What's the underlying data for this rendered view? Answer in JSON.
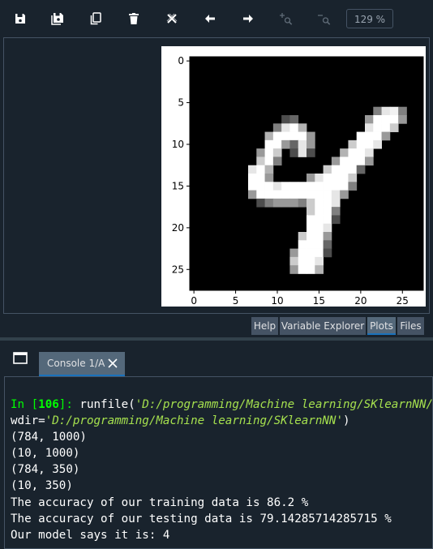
{
  "toolbar": {
    "buttons": [
      {
        "name": "save-icon"
      },
      {
        "name": "save-all-icon"
      },
      {
        "name": "copy-icon"
      },
      {
        "name": "trash-icon"
      },
      {
        "name": "remove-all-icon"
      },
      {
        "name": "arrow-left-icon"
      },
      {
        "name": "arrow-right-icon"
      },
      {
        "name": "zoom-in-icon"
      },
      {
        "name": "zoom-out-icon"
      }
    ],
    "zoom_level": "129 %"
  },
  "chart_data": {
    "type": "heatmap",
    "description_source": "image 28x28 (MNIST digit 4), grayscale",
    "xticks": [
      "0",
      "5",
      "10",
      "15",
      "20",
      "25"
    ],
    "yticks": [
      "0",
      "5",
      "10",
      "15",
      "20",
      "25"
    ],
    "xlim": [
      -0.5,
      27.5
    ],
    "ylim": [
      27.5,
      -0.5
    ],
    "rows": [
      {
        "y": 6,
        "cells": [
          [
            22,
            0.5
          ],
          [
            23,
            0.9
          ],
          [
            24,
            0.95
          ],
          [
            25,
            0.5
          ]
        ]
      },
      {
        "y": 7,
        "cells": [
          [
            11,
            0.3
          ],
          [
            12,
            0.4
          ],
          [
            21,
            0.6
          ],
          [
            22,
            1
          ],
          [
            23,
            1
          ],
          [
            24,
            1
          ],
          [
            25,
            0.6
          ]
        ]
      },
      {
        "y": 8,
        "cells": [
          [
            10,
            0.5
          ],
          [
            11,
            0.9
          ],
          [
            12,
            1
          ],
          [
            13,
            0.7
          ],
          [
            21,
            0.9
          ],
          [
            22,
            1
          ],
          [
            23,
            1
          ],
          [
            24,
            0.8
          ]
        ]
      },
      {
        "y": 9,
        "cells": [
          [
            9,
            0.7
          ],
          [
            10,
            1
          ],
          [
            11,
            1
          ],
          [
            12,
            1
          ],
          [
            13,
            1
          ],
          [
            14,
            0.6
          ],
          [
            20,
            1
          ],
          [
            21,
            1
          ],
          [
            22,
            1
          ],
          [
            23,
            0.6
          ]
        ]
      },
      {
        "y": 10,
        "cells": [
          [
            9,
            1
          ],
          [
            10,
            1
          ],
          [
            11,
            0.6
          ],
          [
            12,
            0.4
          ],
          [
            13,
            0.9
          ],
          [
            14,
            0.6
          ],
          [
            19,
            0.8
          ],
          [
            20,
            1
          ],
          [
            21,
            1
          ],
          [
            22,
            0.9
          ]
        ]
      },
      {
        "y": 11,
        "cells": [
          [
            8,
            0.6
          ],
          [
            9,
            1
          ],
          [
            10,
            0.8
          ],
          [
            12,
            0.3
          ],
          [
            13,
            0.9
          ],
          [
            14,
            0.3
          ],
          [
            18,
            0.7
          ],
          [
            19,
            1
          ],
          [
            20,
            1
          ],
          [
            21,
            0.9
          ]
        ]
      },
      {
        "y": 12,
        "cells": [
          [
            8,
            0.8
          ],
          [
            9,
            1
          ],
          [
            10,
            0.5
          ],
          [
            17,
            0.6
          ],
          [
            18,
            1
          ],
          [
            19,
            1
          ],
          [
            20,
            1
          ],
          [
            21,
            0.6
          ]
        ]
      },
      {
        "y": 13,
        "cells": [
          [
            7,
            0.9
          ],
          [
            8,
            1
          ],
          [
            9,
            0.7
          ],
          [
            16,
            0.8
          ],
          [
            17,
            1
          ],
          [
            18,
            1
          ],
          [
            19,
            1
          ],
          [
            20,
            0.4
          ]
        ]
      },
      {
        "y": 14,
        "cells": [
          [
            7,
            1
          ],
          [
            8,
            1
          ],
          [
            9,
            0.6
          ],
          [
            14,
            0.6
          ],
          [
            15,
            0.9
          ],
          [
            16,
            1
          ],
          [
            17,
            1
          ],
          [
            18,
            1
          ],
          [
            19,
            0.8
          ]
        ]
      },
      {
        "y": 15,
        "cells": [
          [
            7,
            1
          ],
          [
            8,
            1
          ],
          [
            9,
            1
          ],
          [
            10,
            0.9
          ],
          [
            11,
            1
          ],
          [
            12,
            1
          ],
          [
            13,
            1
          ],
          [
            14,
            1
          ],
          [
            15,
            1
          ],
          [
            16,
            1
          ],
          [
            17,
            1
          ],
          [
            18,
            1
          ],
          [
            19,
            0.5
          ]
        ]
      },
      {
        "y": 16,
        "cells": [
          [
            7,
            0.6
          ],
          [
            8,
            1
          ],
          [
            9,
            1
          ],
          [
            10,
            1
          ],
          [
            11,
            1
          ],
          [
            12,
            1
          ],
          [
            13,
            1
          ],
          [
            14,
            1
          ],
          [
            15,
            1
          ],
          [
            16,
            1
          ],
          [
            17,
            0.9
          ],
          [
            18,
            0.6
          ]
        ]
      },
      {
        "y": 17,
        "cells": [
          [
            8,
            0.3
          ],
          [
            9,
            0.5
          ],
          [
            10,
            0.6
          ],
          [
            11,
            0.6
          ],
          [
            12,
            0.6
          ],
          [
            13,
            0.5
          ],
          [
            14,
            0.8
          ],
          [
            15,
            1
          ],
          [
            16,
            1
          ],
          [
            17,
            0.9
          ]
        ]
      },
      {
        "y": 18,
        "cells": [
          [
            14,
            0.8
          ],
          [
            15,
            1
          ],
          [
            16,
            1
          ],
          [
            17,
            0.5
          ]
        ]
      },
      {
        "y": 19,
        "cells": [
          [
            14,
            1
          ],
          [
            15,
            1
          ],
          [
            16,
            1
          ],
          [
            17,
            0.3
          ]
        ]
      },
      {
        "y": 20,
        "cells": [
          [
            14,
            1
          ],
          [
            15,
            1
          ],
          [
            16,
            0.9
          ]
        ]
      },
      {
        "y": 21,
        "cells": [
          [
            13,
            0.8
          ],
          [
            14,
            1
          ],
          [
            15,
            1
          ],
          [
            16,
            0.6
          ]
        ]
      },
      {
        "y": 22,
        "cells": [
          [
            13,
            1
          ],
          [
            14,
            1
          ],
          [
            15,
            1
          ],
          [
            16,
            0.4
          ]
        ]
      },
      {
        "y": 23,
        "cells": [
          [
            12,
            0.6
          ],
          [
            13,
            1
          ],
          [
            14,
            1
          ],
          [
            15,
            1
          ],
          [
            16,
            0.3
          ]
        ]
      },
      {
        "y": 24,
        "cells": [
          [
            12,
            0.8
          ],
          [
            13,
            1
          ],
          [
            14,
            1
          ],
          [
            15,
            0.9
          ]
        ]
      },
      {
        "y": 25,
        "cells": [
          [
            12,
            0.6
          ],
          [
            13,
            1
          ],
          [
            14,
            1
          ],
          [
            15,
            0.7
          ]
        ]
      }
    ]
  },
  "panes": {
    "tabs": [
      {
        "label": "Help",
        "active": false
      },
      {
        "label": "Variable Explorer",
        "active": false
      },
      {
        "label": "Plots",
        "active": true
      },
      {
        "label": "Files",
        "active": false
      }
    ]
  },
  "console": {
    "tab_label": "Console 1/A",
    "prompt_prefix": "In [",
    "prompt_number": "106",
    "prompt_suffix": "]: ",
    "command": "runfile(",
    "command_arg": "'D:/programming/Machine learning/SKlearnNN/main.py'",
    "wdir_prefix": "wdir=",
    "wdir_arg": "'D:/programming/Machine learning/SKlearnNN'",
    "wdir_close": ")",
    "output": [
      "(784, 1000)",
      "(10, 1000)",
      "(784, 350)",
      "(10, 350)",
      "The accuracy of our training data is 86.2 %",
      "The accuracy of our testing data is 79.14285714285715 %",
      "Our model says it is: 4"
    ]
  }
}
